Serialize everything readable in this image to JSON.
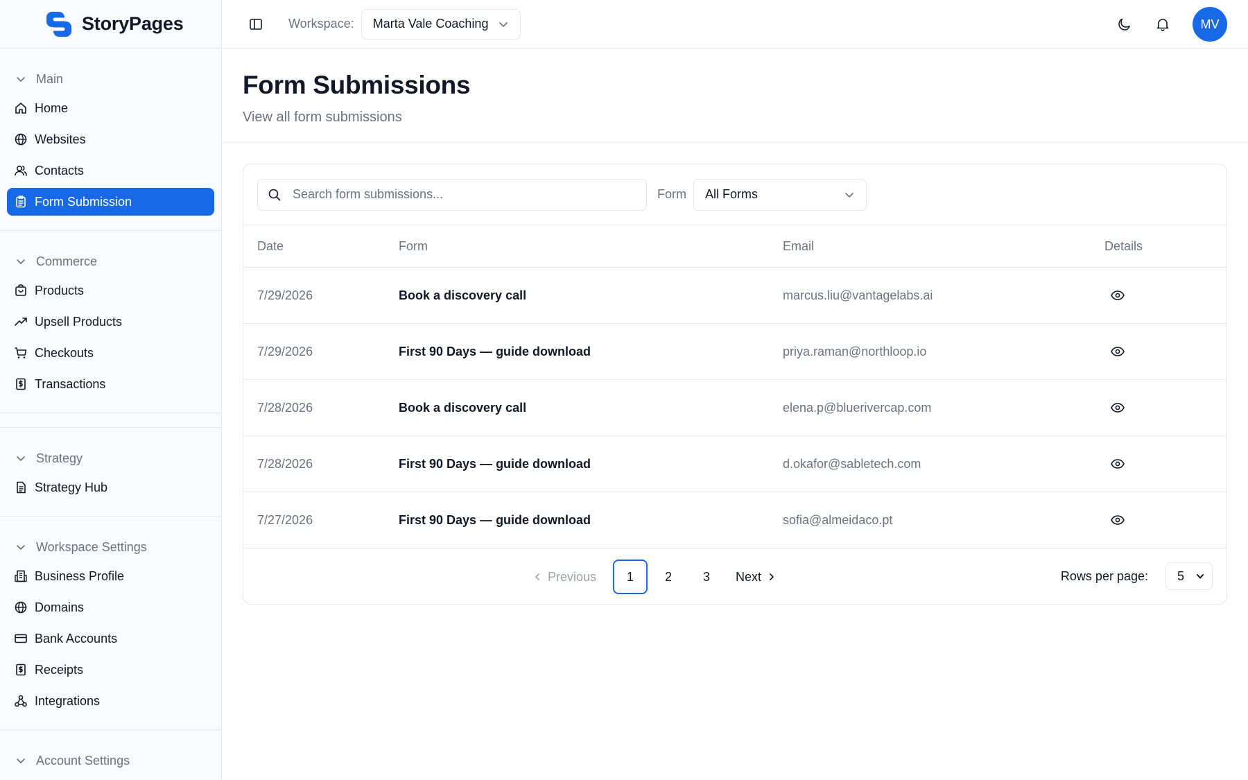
{
  "app": {
    "name": "StoryPages"
  },
  "colors": {
    "accent": "#1769e8",
    "muted": "#6b7280",
    "border": "#e5e7eb"
  },
  "header": {
    "workspace_label": "Workspace:",
    "workspace_value": "Marta Vale Coaching",
    "avatar_initials": "MV",
    "icons": [
      "sidebar-toggle-icon",
      "moon-icon",
      "bell-icon"
    ]
  },
  "sidebar": {
    "sections": [
      {
        "title": "Main",
        "items": [
          {
            "label": "Home",
            "icon": "home-icon"
          },
          {
            "label": "Websites",
            "icon": "globe-icon"
          },
          {
            "label": "Contacts",
            "icon": "users-icon"
          },
          {
            "label": "Form Submission",
            "icon": "clipboard-icon",
            "active": true
          }
        ]
      },
      {
        "title": "Commerce",
        "items": [
          {
            "label": "Products",
            "icon": "package-icon"
          },
          {
            "label": "Upsell Products",
            "icon": "trending-up-icon"
          },
          {
            "label": "Checkouts",
            "icon": "cart-icon"
          },
          {
            "label": "Transactions",
            "icon": "receipt-icon"
          }
        ]
      },
      {
        "title": "Strategy",
        "items": [
          {
            "label": "Strategy Hub",
            "icon": "document-icon"
          }
        ]
      },
      {
        "title": "Workspace Settings",
        "items": [
          {
            "label": "Business Profile",
            "icon": "building-icon"
          },
          {
            "label": "Domains",
            "icon": "globe-icon"
          },
          {
            "label": "Bank Accounts",
            "icon": "credit-card-icon"
          },
          {
            "label": "Receipts",
            "icon": "receipt-icon"
          },
          {
            "label": "Integrations",
            "icon": "webhook-icon"
          }
        ]
      },
      {
        "title": "Account Settings",
        "items": []
      }
    ]
  },
  "page": {
    "title": "Form Submissions",
    "subtitle": "View all form submissions"
  },
  "filters": {
    "search_placeholder": "Search form submissions...",
    "form_label": "Form",
    "form_value": "All Forms"
  },
  "table": {
    "columns": [
      "Date",
      "Form",
      "Email",
      "Details"
    ],
    "rows": [
      {
        "date": "7/29/2026",
        "form": "Book a discovery call",
        "email": "marcus.liu@vantagelabs.ai"
      },
      {
        "date": "7/29/2026",
        "form": "First 90 Days — guide download",
        "email": "priya.raman@northloop.io"
      },
      {
        "date": "7/28/2026",
        "form": "Book a discovery call",
        "email": "elena.p@bluerivercap.com"
      },
      {
        "date": "7/28/2026",
        "form": "First 90 Days — guide download",
        "email": "d.okafor@sabletech.com"
      },
      {
        "date": "7/27/2026",
        "form": "First 90 Days — guide download",
        "email": "sofia@almeidaco.pt"
      }
    ]
  },
  "pagination": {
    "previous_label": "Previous",
    "next_label": "Next",
    "pages": [
      "1",
      "2",
      "3"
    ],
    "current_page": "1",
    "rows_per_page_label": "Rows per page:",
    "rows_per_page_value": "5"
  }
}
